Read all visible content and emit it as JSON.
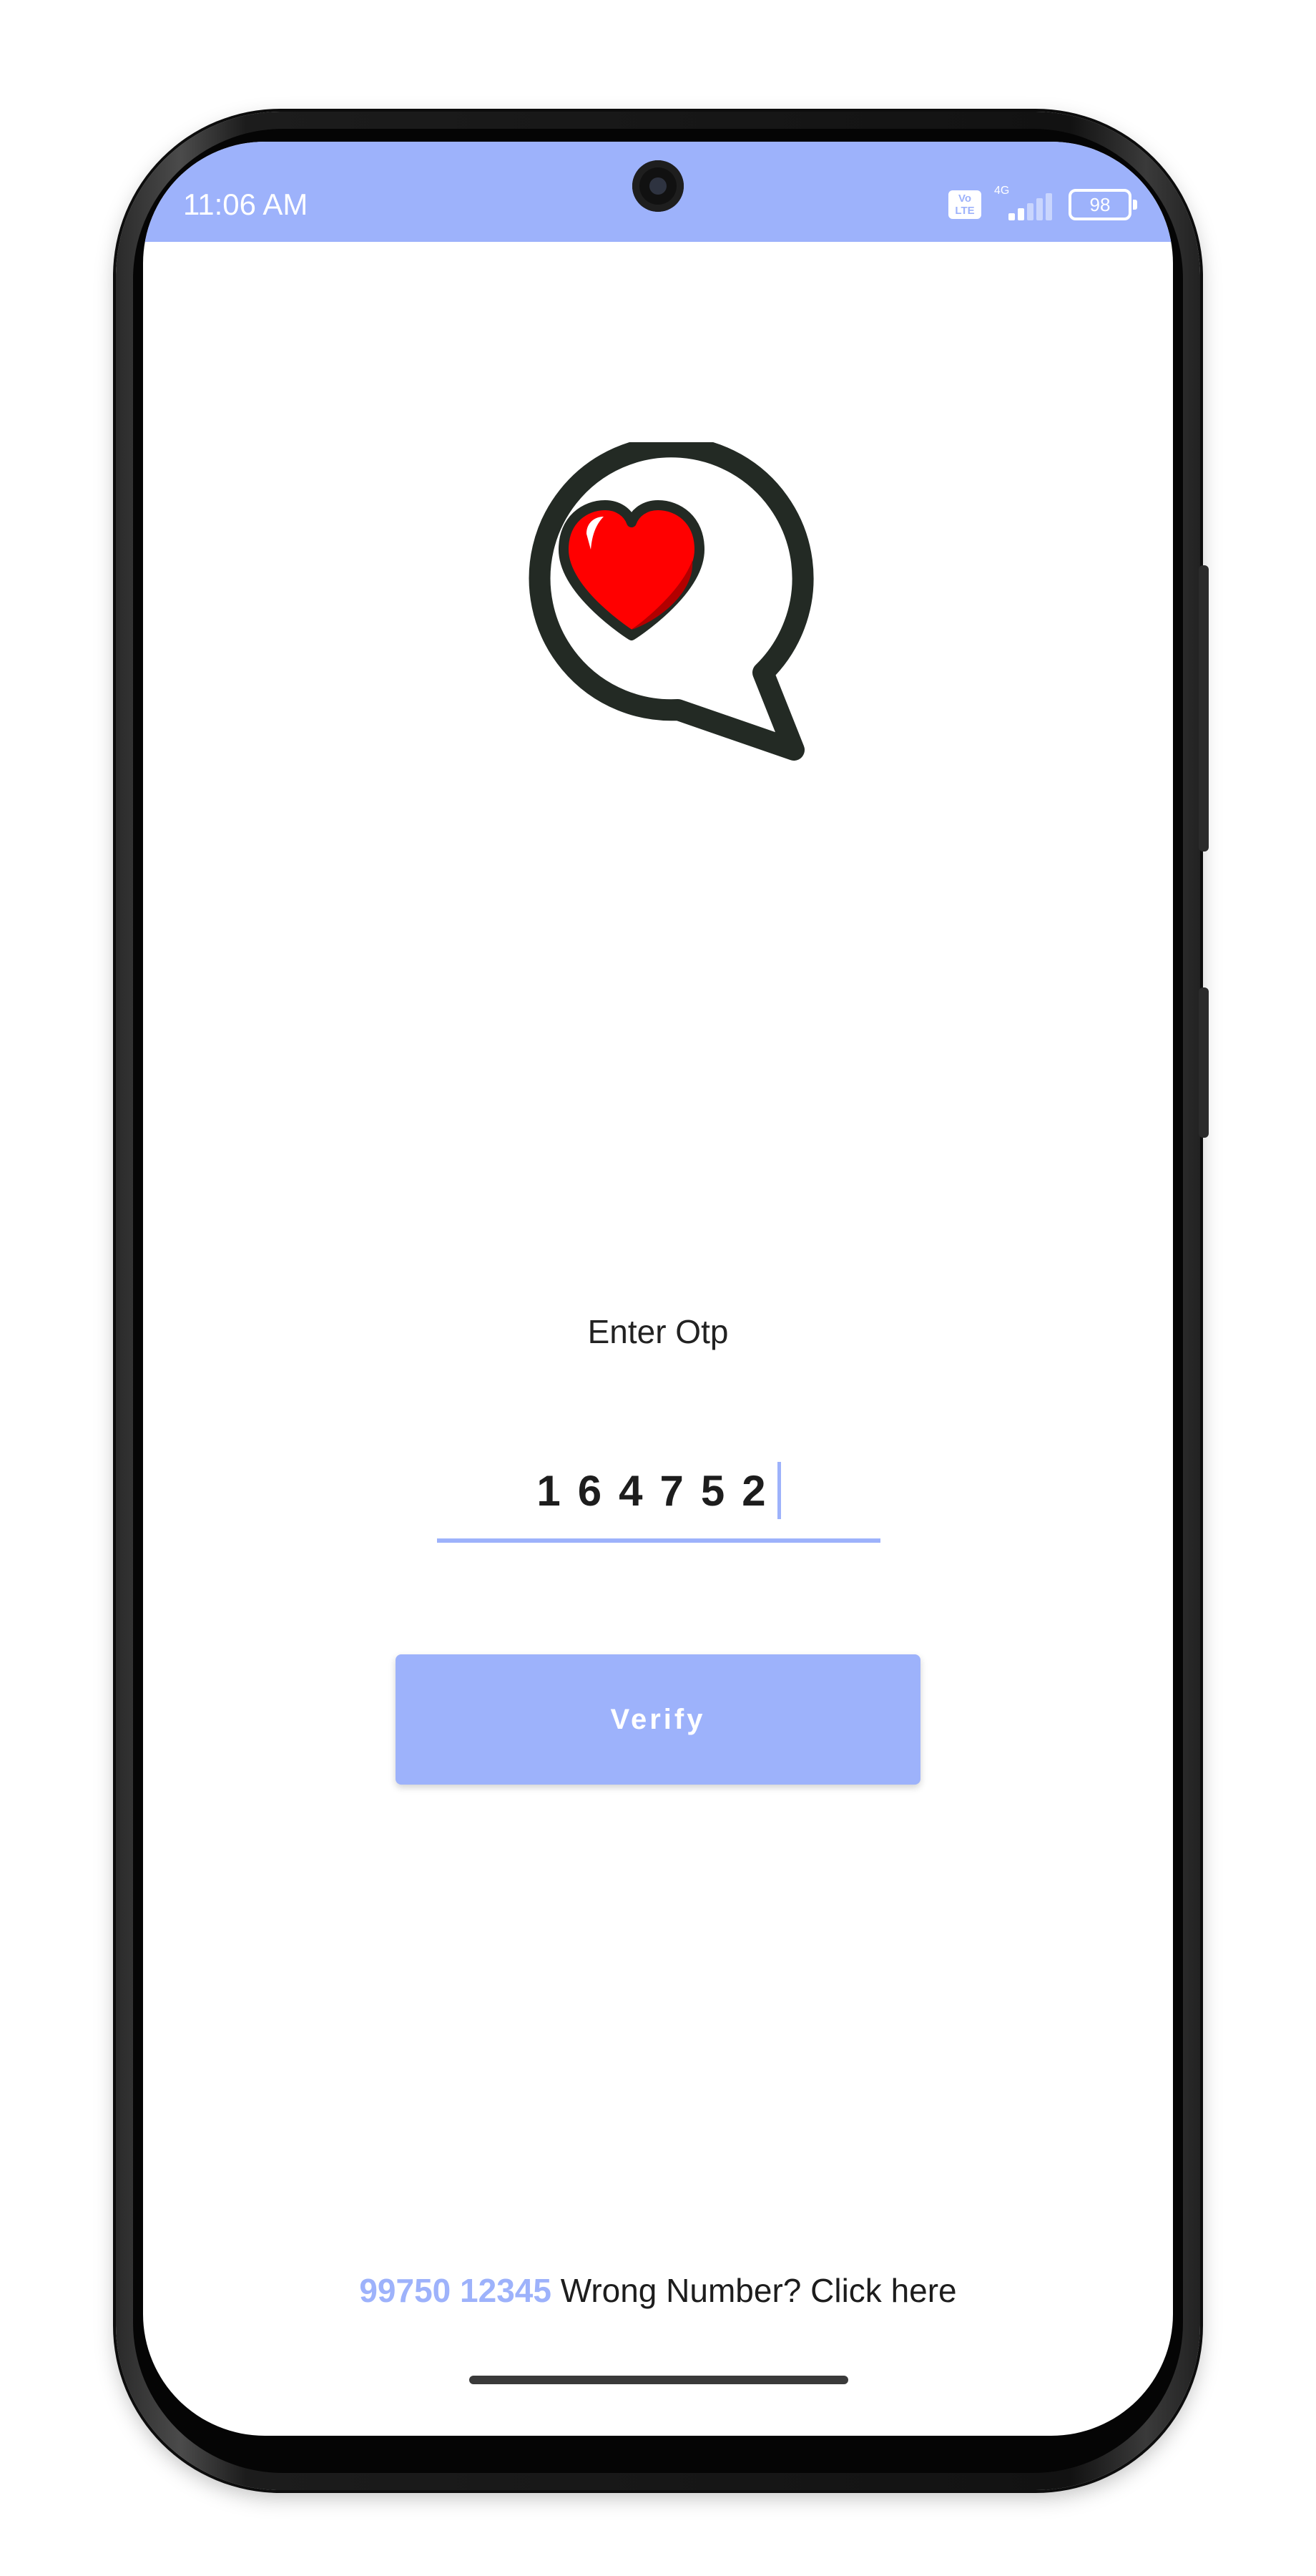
{
  "status_bar": {
    "time": "11:06 AM",
    "volte_line1": "Vo",
    "volte_line2": "LTE",
    "network": "4G",
    "signal_level": 2,
    "signal_max": 5,
    "battery": "98"
  },
  "logo": {
    "icon": "heart-chat-bubble-icon",
    "heart_color": "#ff0000",
    "outline_color": "#232a24"
  },
  "otp": {
    "label": "Enter Otp",
    "value": "164752"
  },
  "verify_button": {
    "label": "Verify"
  },
  "footer": {
    "phone_number": "99750 12345",
    "prompt": "Wrong Number? Click here"
  },
  "colors": {
    "accent": "#9db2fb",
    "text": "#1d1d1d"
  }
}
